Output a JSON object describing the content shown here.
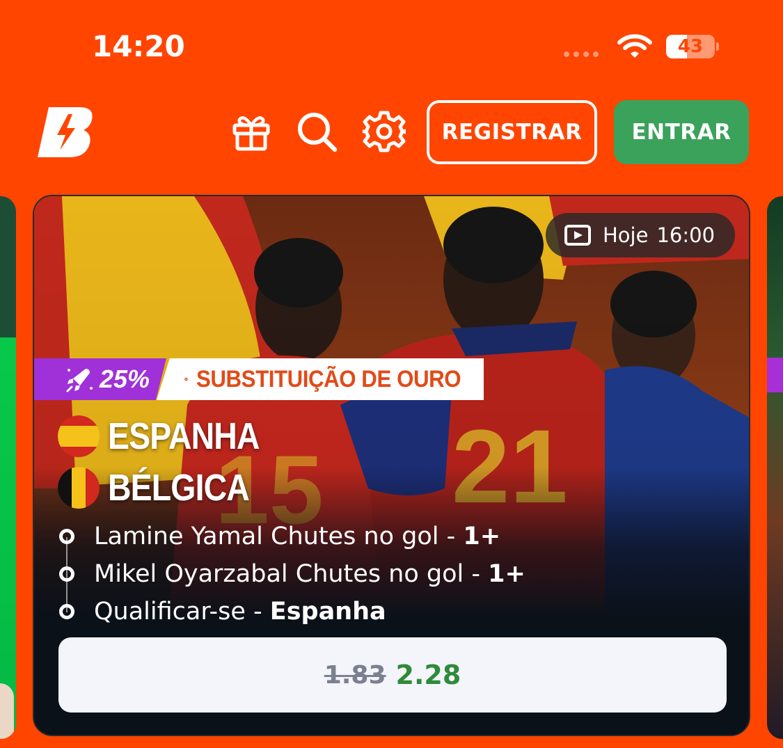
{
  "status_bar": {
    "time": "14:20",
    "battery_level": "43",
    "battery_fraction": 0.43
  },
  "header": {
    "icons": [
      "logo-icon",
      "gift-icon",
      "search-icon",
      "gear-icon"
    ],
    "register_label": "REGISTRAR",
    "login_label": "ENTRAR"
  },
  "colors": {
    "background": "#ff4500",
    "login_button": "#3aa25a",
    "promo_purple": "#a030d8",
    "promo_orange_text": "#e24a18",
    "odds_new": "#2f8a3a"
  },
  "card": {
    "schedule_label": "Hoje",
    "schedule_time": "16:00",
    "promo_percent": "25%",
    "promo_title": "SUBSTITUIÇÃO DE OURO",
    "team_home": "ESPANHA",
    "team_away": "BÉLGICA",
    "selections": [
      {
        "text": "Lamine Yamal Chutes no gol - ",
        "pick": "1+"
      },
      {
        "text": "Mikel Oyarzabal Chutes no gol - ",
        "pick": "1+"
      },
      {
        "text": "Qualificar-se - ",
        "pick": "Espanha"
      }
    ],
    "odds_old": "1.83",
    "odds_new": "2.28"
  }
}
